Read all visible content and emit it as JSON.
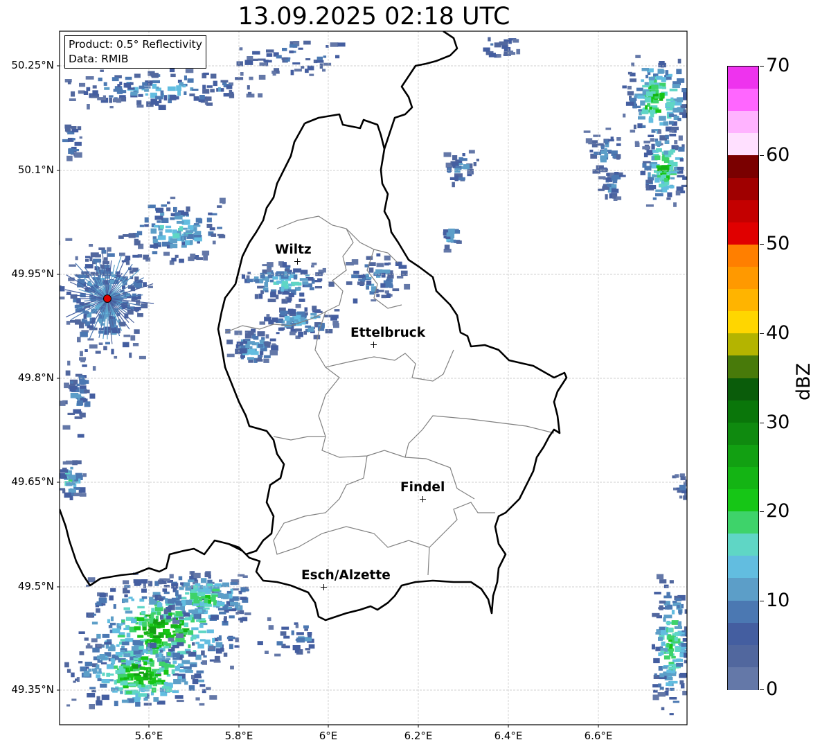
{
  "title": "13.09.2025 02:18 UTC",
  "info": {
    "product": "Product: 0.5° Reflectivity",
    "data_source": "Data: RMIB"
  },
  "axes": {
    "lat_labels": [
      "50.25°N",
      "50.1°N",
      "49.95°N",
      "49.8°N",
      "49.65°N",
      "49.5°N",
      "49.35°N"
    ],
    "lon_labels": [
      "5.6°E",
      "5.8°E",
      "6°E",
      "6.2°E",
      "6.4°E",
      "6.6°E"
    ]
  },
  "cities": [
    {
      "name": "Wiltz"
    },
    {
      "name": "Ettelbruck"
    },
    {
      "name": "Findel"
    },
    {
      "name": "Esch/Alzette"
    }
  ],
  "colorbar": {
    "unit": "dBZ",
    "tick_labels": [
      "70",
      "60",
      "50",
      "40",
      "30",
      "20",
      "10",
      "0"
    ],
    "colors": [
      "#ee33ee",
      "#ff66ff",
      "#ffb3ff",
      "#ffe0ff",
      "#7a0000",
      "#a00000",
      "#c40000",
      "#e00000",
      "#ff7f00",
      "#ff9900",
      "#ffb400",
      "#ffd600",
      "#b4b400",
      "#487a0a",
      "#0a5c0a",
      "#0a760a",
      "#0f8a0f",
      "#12a012",
      "#14b414",
      "#16c616",
      "#3ed36a",
      "#5fd6c5",
      "#62bde0",
      "#5c9ec8",
      "#4b78b2",
      "#445ea0",
      "#51679e",
      "#6478a8"
    ]
  },
  "radar_site_color": "#e00000",
  "border_color": "#000000",
  "canton_color": "#808080",
  "grid_color": "#c0c0c0"
}
